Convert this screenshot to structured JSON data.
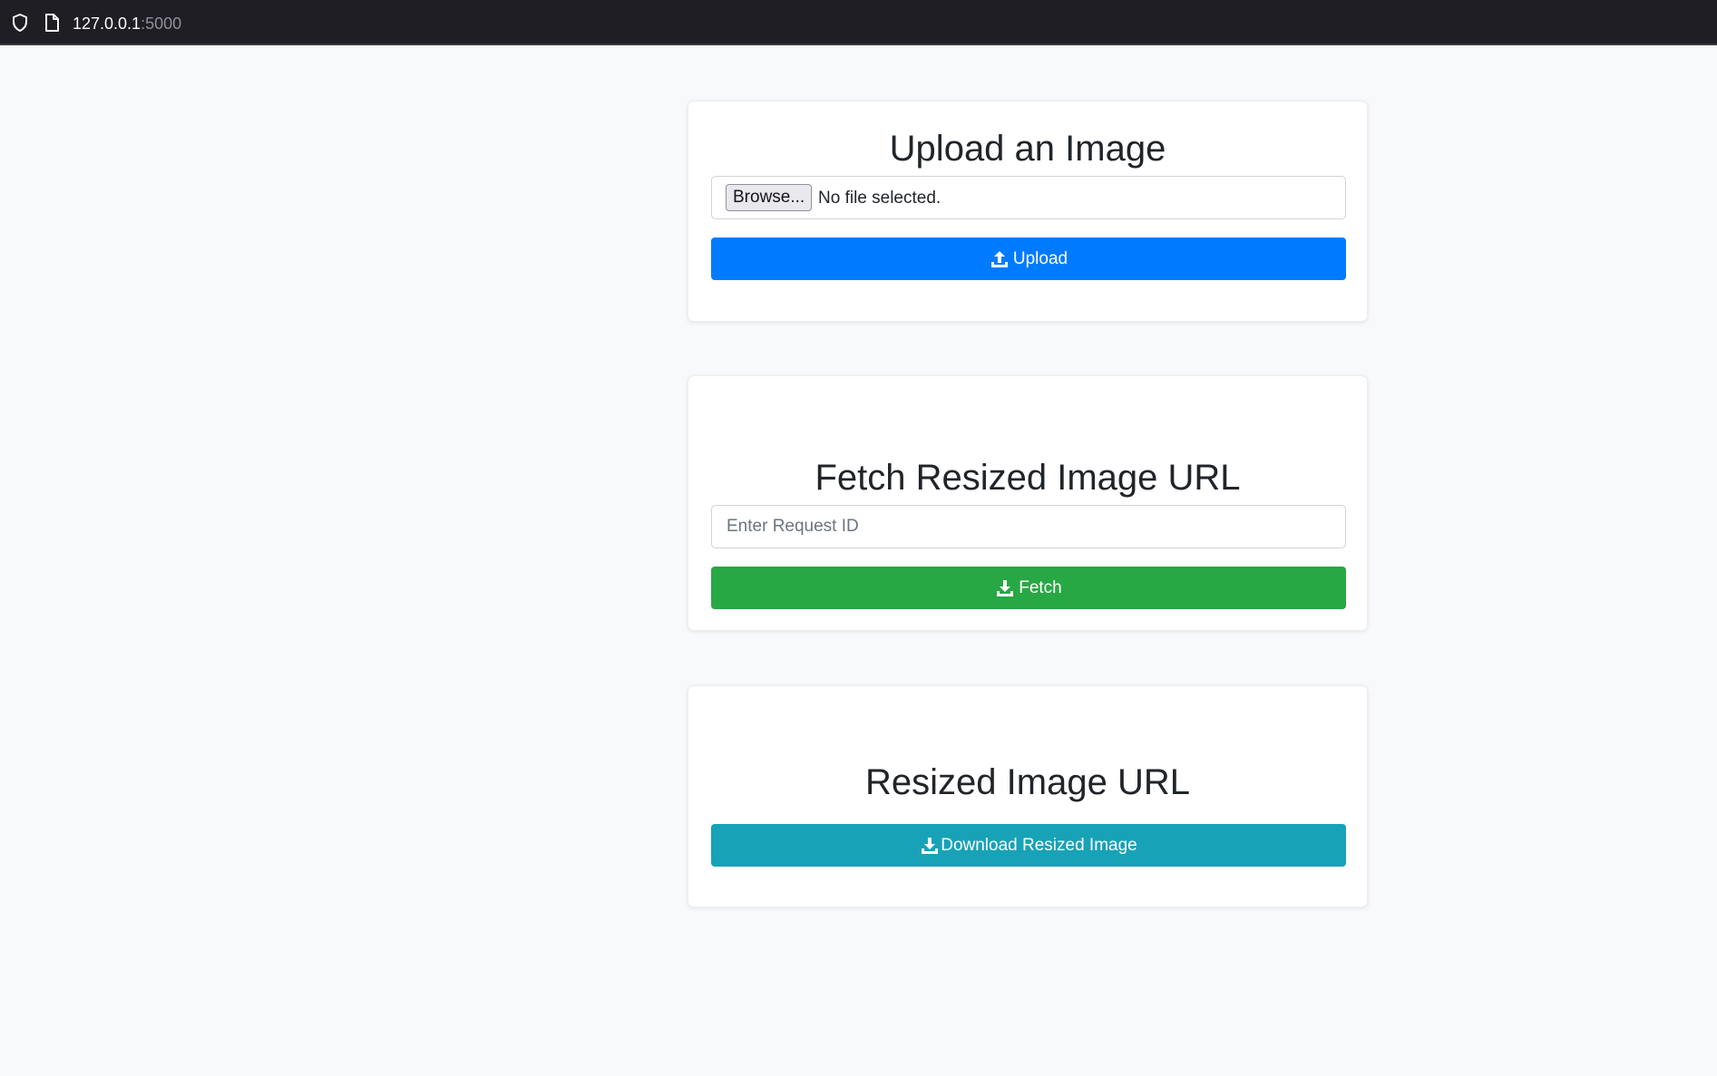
{
  "browser": {
    "url_host": "127.0.0.1",
    "url_port": ":5000"
  },
  "upload_card": {
    "title": "Upload an Image",
    "browse_label": "Browse...",
    "file_status": "No file selected.",
    "upload_label": "Upload",
    "button_color": "#007bff"
  },
  "fetch_card": {
    "title": "Fetch Resized Image URL",
    "input_placeholder": "Enter Request ID",
    "input_value": "",
    "fetch_label": "Fetch",
    "button_color": "#28a745"
  },
  "download_card": {
    "title": "Resized Image URL",
    "download_label": "Download Resized Image",
    "button_color": "#17a2b8"
  },
  "icons": {
    "address_bar": [
      "shield-icon",
      "page-icon"
    ],
    "buttons": [
      "upload-icon",
      "download-icon"
    ]
  }
}
